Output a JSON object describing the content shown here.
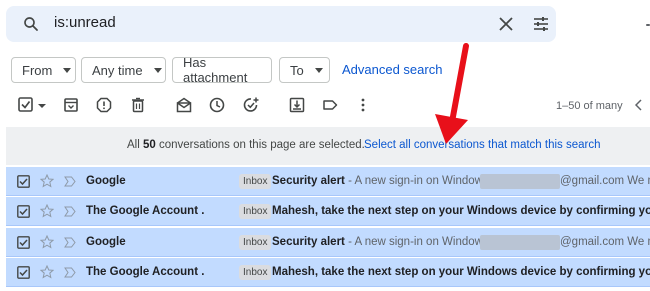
{
  "search": {
    "query": "is:unread",
    "icons": {
      "search": "search-icon",
      "clear": "close-icon",
      "options": "tune-icon"
    }
  },
  "filters": {
    "chips": [
      {
        "label": "From",
        "has_caret": true
      },
      {
        "label": "Any time",
        "has_caret": true
      },
      {
        "label": "Has attachment",
        "has_caret": false
      },
      {
        "label": "To",
        "has_caret": true
      }
    ],
    "advanced_search": "Advanced search"
  },
  "toolbar": {
    "icons": [
      "select-all-checkbox-icon",
      "caret-down-icon",
      "archive-icon",
      "report-spam-icon",
      "delete-icon",
      "mark-as-read-icon",
      "snooze-icon",
      "add-to-tasks-icon",
      "move-to-icon",
      "label-icon",
      "more-icon"
    ],
    "pager": "1–50 of many"
  },
  "selection_banner": {
    "prefix": "All ",
    "count": "50",
    "suffix": " conversations on this page are selected.",
    "select_all_link": "Select all conversations that match this search"
  },
  "emails": [
    {
      "sender": "Google",
      "label": "Inbox",
      "subject": "Security alert",
      "snippet": " - A new sign-in on Windows",
      "after_redaction": "@gmail.com We n"
    },
    {
      "sender": "The Google Account .",
      "label": "Inbox",
      "subject": "Mahesh, take the next step on your Windows device by confirming your G",
      "snippet": "",
      "after_redaction": ""
    },
    {
      "sender": "Google",
      "label": "Inbox",
      "subject": "Security alert",
      "snippet": " - A new sign-in on Windows",
      "after_redaction": "@gmail.com We n"
    },
    {
      "sender": "The Google Account .",
      "label": "Inbox",
      "subject": "Mahesh, take the next step on your Windows device by confirming your G",
      "snippet": "",
      "after_redaction": ""
    }
  ],
  "colors": {
    "selected_row": "#c2dbff",
    "link": "#0b57d0",
    "annotation_arrow": "#e8101a"
  }
}
